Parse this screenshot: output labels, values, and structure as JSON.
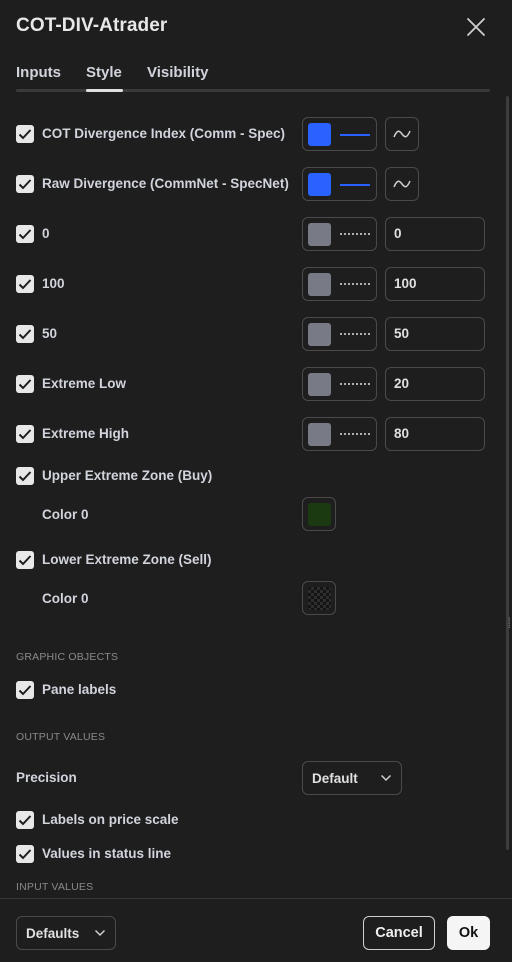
{
  "dialog": {
    "title": "COT-DIV-Atrader"
  },
  "tabs": [
    {
      "label": "Inputs",
      "active": false
    },
    {
      "label": "Style",
      "active": true
    },
    {
      "label": "Visibility",
      "active": false
    }
  ],
  "plots": [
    {
      "label": "COT Divergence Index (Comm - Spec)",
      "checked": true,
      "color": "#2962ff",
      "line": "solid"
    },
    {
      "label": "Raw Divergence (CommNet - SpecNet)",
      "checked": true,
      "color": "#2962ff",
      "line": "solid"
    }
  ],
  "hlines": [
    {
      "label": "0",
      "checked": true,
      "color": "#787b86",
      "line": "dotted",
      "value": "0"
    },
    {
      "label": "100",
      "checked": true,
      "color": "#787b86",
      "line": "dotted",
      "value": "100"
    },
    {
      "label": "50",
      "checked": true,
      "color": "#787b86",
      "line": "dotted",
      "value": "50"
    },
    {
      "label": "Extreme Low",
      "checked": true,
      "color": "#787b86",
      "line": "dotted",
      "value": "20"
    },
    {
      "label": "Extreme High",
      "checked": true,
      "color": "#787b86",
      "line": "dotted",
      "value": "80"
    }
  ],
  "zones": [
    {
      "label": "Upper Extreme Zone (Buy)",
      "checked": true,
      "color_label": "Color 0",
      "color": "#1b3a12"
    },
    {
      "label": "Lower Extreme Zone (Sell)",
      "checked": true,
      "color_label": "Color 0",
      "color": "transparent"
    }
  ],
  "graphic_objects": {
    "section_title": "GRAPHIC OBJECTS",
    "pane_labels": {
      "label": "Pane labels",
      "checked": true
    }
  },
  "output_values": {
    "section_title": "OUTPUT VALUES",
    "precision_label": "Precision",
    "precision_value": "Default",
    "labels_on_price_scale": {
      "label": "Labels on price scale",
      "checked": true
    },
    "values_in_status_line": {
      "label": "Values in status line",
      "checked": true
    }
  },
  "input_values": {
    "section_title": "INPUT VALUES"
  },
  "footer": {
    "defaults_label": "Defaults",
    "cancel_label": "Cancel",
    "ok_label": "Ok"
  },
  "icons": {
    "close": "close-icon",
    "check": "check-icon",
    "plot_type": "line-plot-type-icon",
    "chevron": "chevron-down-icon"
  },
  "colors": {
    "background": "#1e1e1e",
    "accent": "#2962ff",
    "text": "#d1d4dc"
  }
}
